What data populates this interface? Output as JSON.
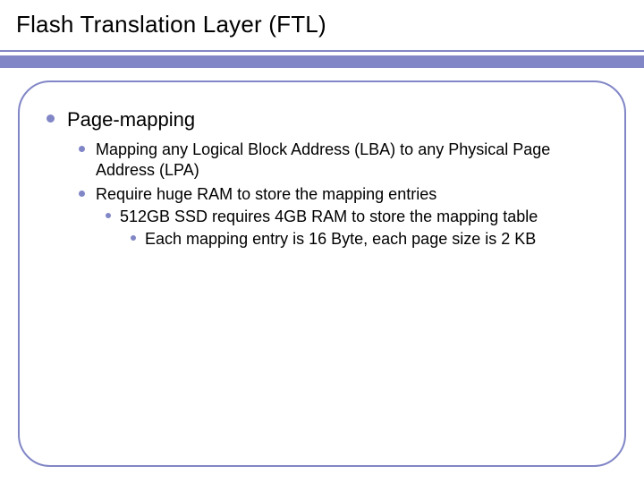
{
  "slide": {
    "title": "Flash Translation Layer (FTL)",
    "accent_color": "#8186c6",
    "bullets": {
      "l1": {
        "text": "Page-mapping",
        "children": [
          {
            "text": "Mapping any Logical Block Address (LBA) to any Physical Page Address (LPA)"
          },
          {
            "text": "Require huge RAM to store the mapping entries",
            "children": [
              {
                "text": "512GB SSD requires 4GB RAM to store the mapping table",
                "children": [
                  {
                    "text": "Each mapping entry is 16 Byte, each page size is 2 KB"
                  }
                ]
              }
            ]
          }
        ]
      }
    }
  }
}
